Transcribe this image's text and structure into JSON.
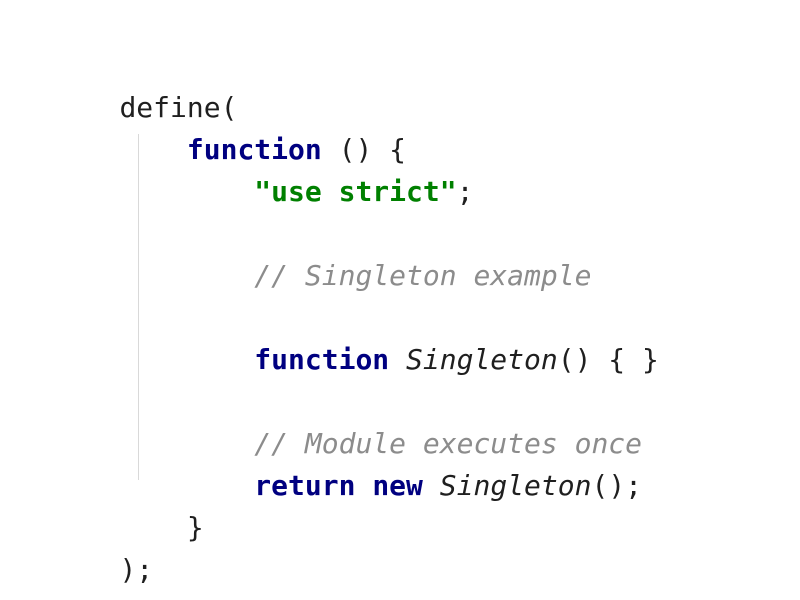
{
  "code": {
    "line1": {
      "text": "define("
    },
    "line2": {
      "indent": "    ",
      "keyword": "function",
      "rest": " () {"
    },
    "line3": {
      "indent": "        ",
      "string": "\"use strict\"",
      "rest": ";"
    },
    "line5": {
      "indent": "        ",
      "comment": "// Singleton example"
    },
    "line7": {
      "indent": "        ",
      "keyword": "function",
      "space": " ",
      "name": "Singleton",
      "rest": "() { }"
    },
    "line9": {
      "indent": "        ",
      "comment": "// Module executes once"
    },
    "line10": {
      "indent": "        ",
      "keyword1": "return",
      "space1": " ",
      "keyword2": "new",
      "space2": " ",
      "name": "Singleton",
      "rest": "();"
    },
    "line11": {
      "indent": "    ",
      "text": "}"
    },
    "line12": {
      "text": ");"
    }
  },
  "colors": {
    "keyword": "#000080",
    "string": "#008000",
    "comment": "#8c8c8c",
    "text": "#1f1f1f",
    "background": "#ffffff",
    "indent_guide": "#d9d9d9"
  }
}
